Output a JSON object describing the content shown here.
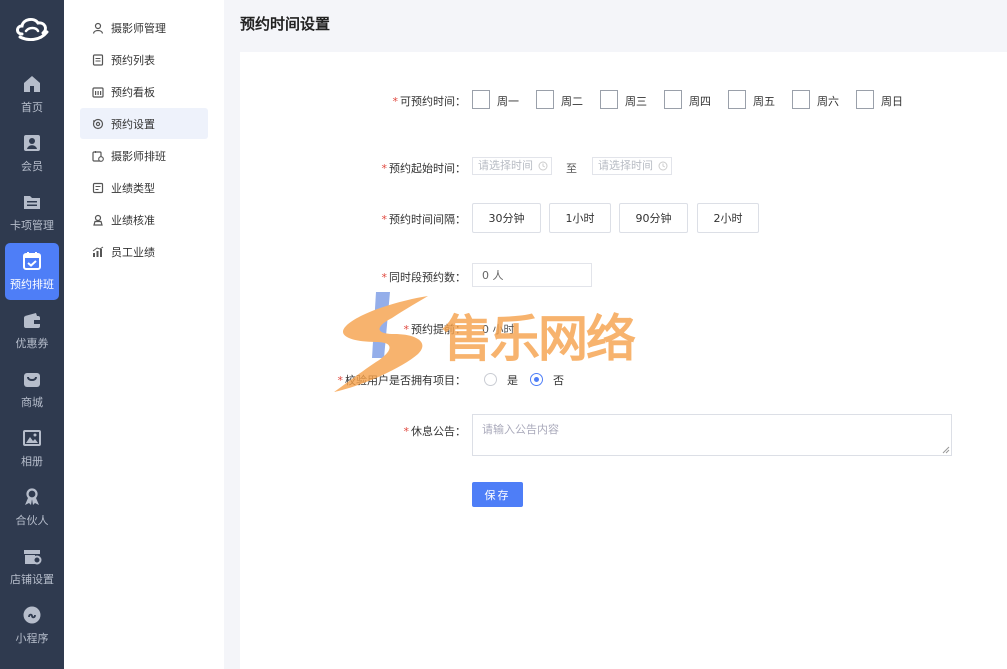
{
  "colors": {
    "rail_bg": "#2f3a4f",
    "accent": "#4e7ef7",
    "required": "#e0483e",
    "watermark_orange": "#f6a14a",
    "watermark_blue": "#3b6fd9"
  },
  "rail": {
    "items": [
      {
        "label": "首页",
        "icon": "home-icon"
      },
      {
        "label": "会员",
        "icon": "member-card-icon"
      },
      {
        "label": "卡项管理",
        "icon": "folder-list-icon"
      },
      {
        "label": "预约排班",
        "icon": "calendar-check-icon",
        "active": true
      },
      {
        "label": "优惠券",
        "icon": "wallet-icon"
      },
      {
        "label": "商城",
        "icon": "shopping-bag-icon"
      },
      {
        "label": "相册",
        "icon": "image-icon"
      },
      {
        "label": "合伙人",
        "icon": "partner-icon"
      },
      {
        "label": "店铺设置",
        "icon": "store-settings-icon"
      },
      {
        "label": "小程序",
        "icon": "mini-program-icon"
      }
    ]
  },
  "submenu": {
    "items": [
      {
        "label": "摄影师管理",
        "icon": "user-icon"
      },
      {
        "label": "预约列表",
        "icon": "list-icon"
      },
      {
        "label": "预约看板",
        "icon": "board-icon"
      },
      {
        "label": "预约设置",
        "icon": "settings-icon",
        "active": true
      },
      {
        "label": "摄影师排班",
        "icon": "schedule-icon"
      },
      {
        "label": "业绩类型",
        "icon": "type-icon"
      },
      {
        "label": "业绩核准",
        "icon": "approve-icon"
      },
      {
        "label": "员工业绩",
        "icon": "chart-icon"
      }
    ]
  },
  "page": {
    "title": "预约时间设置"
  },
  "form": {
    "weekdays_label": "可预约时间：",
    "weekdays": [
      "周一",
      "周二",
      "周三",
      "周四",
      "周五",
      "周六",
      "周日"
    ],
    "start_time_label": "预约起始时间：",
    "start_placeholder": "请选择时间",
    "range_separator": "至",
    "end_placeholder": "请选择时间",
    "interval_label": "预约时间间隔：",
    "interval_options": [
      "30分钟",
      "1小时",
      "90分钟",
      "2小时"
    ],
    "concurrent_label": "同时段预约数：",
    "concurrent_value": "0 人",
    "advance_label": "预约提前：",
    "advance_value": "0 小时",
    "verify_label": "校验用户是否拥有项目：",
    "verify_yes": "是",
    "verify_no": "否",
    "verify_selected": "否",
    "notice_label": "休息公告：",
    "notice_placeholder": "请输入公告内容",
    "save_label": "保存"
  },
  "watermark": {
    "text": "售乐网络"
  }
}
